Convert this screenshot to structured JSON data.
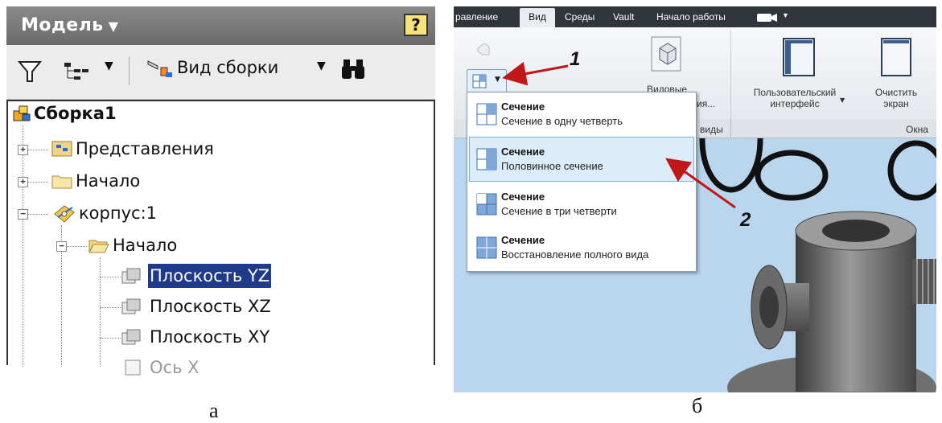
{
  "panel_a": {
    "header_title": "Модель",
    "help_label": "?",
    "toolbar": {
      "assembly_view_label": "Вид сборки"
    },
    "tree": {
      "root": "Сборка1",
      "items": [
        {
          "label": "Представления"
        },
        {
          "label": "Начало"
        },
        {
          "label": "корпус:1"
        },
        {
          "label": "Начало"
        },
        {
          "label": "Плоскость YZ"
        },
        {
          "label": "Плоскость XZ"
        },
        {
          "label": "Плоскость XY"
        },
        {
          "label": "Ось X"
        }
      ]
    },
    "caption": "а"
  },
  "panel_b": {
    "tabs": [
      {
        "label": "равление"
      },
      {
        "label": "Вид"
      },
      {
        "label": "Среды"
      },
      {
        "label": "Vault"
      },
      {
        "label": "Начало работы"
      }
    ],
    "ribbon": {
      "view_styles_line1": "Видовые",
      "view_styles_line2": "ия...",
      "user_interface_line1": "Пользовательский",
      "user_interface_line2": "интерфейс",
      "clear_screen_line1": "Очистить",
      "clear_screen_line2": "экран",
      "group_views": "виды",
      "group_windows": "Окна"
    },
    "menu": [
      {
        "title": "Сечение",
        "subtitle": "Сечение в одну четверть"
      },
      {
        "title": "Сечение",
        "subtitle": "Половинное сечение"
      },
      {
        "title": "Сечение",
        "subtitle": "Сечение в три четверти"
      },
      {
        "title": "Сечение",
        "subtitle": "Восстановление полного вида"
      }
    ],
    "annotation_1": "1",
    "annotation_2": "2",
    "caption": "б"
  },
  "colors": {
    "selection": "#1f3a8a",
    "menu_highlight": "#dcecfb",
    "arrow": "#c01818",
    "viewport": "#b9d6ee"
  }
}
